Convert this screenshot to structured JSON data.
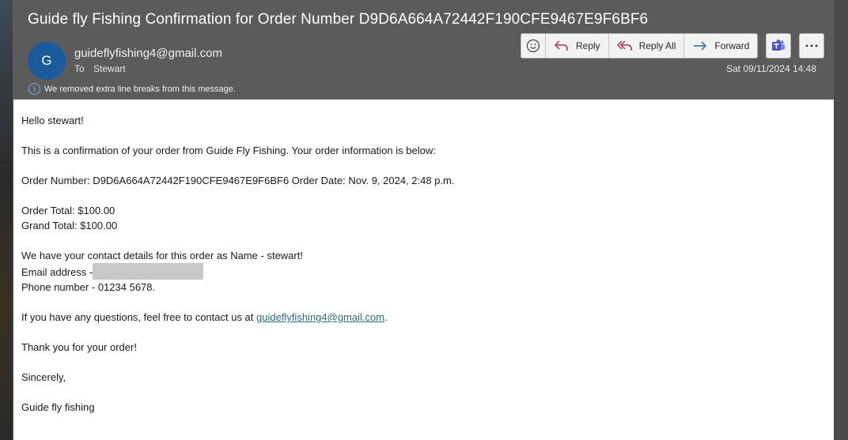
{
  "message": {
    "subject": "Guide fly Fishing Confirmation for Order Number D9D6A664A72442F190CFE9467E9F6BF6",
    "avatar_initial": "G",
    "sender": "guideflyfishing4@gmail.com",
    "to_label": "To",
    "to_value": "Stewart",
    "info_text": "We removed extra line breaks from this message.",
    "date": "Sat 09/11/2024 14:48"
  },
  "toolbar": {
    "reply": "Reply",
    "reply_all": "Reply All",
    "forward": "Forward"
  },
  "body": {
    "greeting": "Hello stewart!",
    "intro": "This is a confirmation of your order from Guide Fly Fishing. Your order information is below:",
    "order_line": "Order Number: D9D6A664A72442F190CFE9467E9F6BF6 Order Date: Nov. 9, 2024, 2:48 p.m.",
    "order_total": "Order Total: $100.00",
    "grand_total": "Grand Total: $100.00",
    "contact_line": "We have your contact details for this order as Name  - stewart!",
    "email_label": "Email address -",
    "phone_line": "Phone number -  01234 5678.",
    "questions_prefix": "If you have any questions, feel free to contact us at ",
    "questions_link": "guideflyfishing4@gmail.com",
    "questions_suffix": ".",
    "thanks": "Thank you for your order!",
    "sincerely": "Sincerely,",
    "signature": "Guide fly fishing"
  },
  "colors": {
    "header_bg": "#5b5b5b",
    "avatar_bg": "#1b5a9c",
    "reply_arrow": "#b0305a",
    "forward_arrow": "#2b5eb8",
    "link": "#2f6c7a"
  }
}
